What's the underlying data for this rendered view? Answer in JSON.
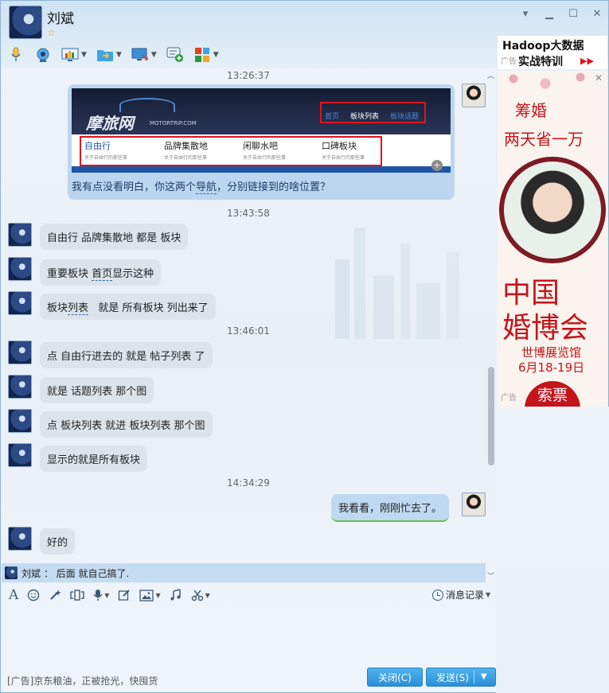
{
  "contact": {
    "name": "刘斌",
    "star": "☆"
  },
  "window": {
    "minimize_label": "▾",
    "min_label": "▁",
    "max_label": "☐",
    "close_label": "✕"
  },
  "chat": {
    "times": [
      "13:26:37",
      "13:43:58",
      "13:46:01",
      "14:34:29"
    ],
    "image_message": {
      "site_logo": "摩旅网",
      "site_logo_sub": "MOTORTRIP.COM",
      "site_nav": [
        "首页",
        "板块列表",
        "板块话题"
      ],
      "site_menu": [
        {
          "title": "自由行",
          "sub": "关于自由行的那些事"
        },
        {
          "title": "品牌集散地",
          "sub": "关于自由行的那些事"
        },
        {
          "title": "闲聊水吧",
          "sub": "关于自由行的那些事"
        },
        {
          "title": "口碑板块",
          "sub": "关于自由行的那些事"
        }
      ],
      "caption_a": "我有点没看明白，你这两个",
      "caption_link": "导航",
      "caption_b": "，分别链接到的啥位置？"
    },
    "messages": [
      {
        "text": "自由行 品牌集散地 都是 板块"
      },
      {
        "text_a": "重要板块 ",
        "link": "首页",
        "text_b": "显示这种"
      },
      {
        "text_a": "板块",
        "link": "列表",
        "text_b": "   就是 所有板块 列出来了"
      },
      {
        "text": "点 自由行进去的 就是 帖子列表 了"
      },
      {
        "text": "就是 话题列表 那个图"
      },
      {
        "text": "点 板块列表 就进 板块列表 那个图"
      },
      {
        "text": "显示的就是所有板块"
      },
      {
        "text": "我看看，刚刚忙去了。"
      },
      {
        "text": "好的"
      }
    ]
  },
  "status_line": "刘斌 ： 后面 就自己搞了.",
  "input_toolbar": {
    "history_label": "消息记录"
  },
  "footer": {
    "ad_text": "[广告]京东粮油，正被抢光，快囤货",
    "close_button": "关闭(C)",
    "send_button": "发送(S)"
  },
  "ads": {
    "ad1_line1": "Hadoop大数据",
    "ad1_line2": "实战特训",
    "ad1_tag": "广告",
    "ad2_h1": "筹婚",
    "ad2_h2": "两天省一万",
    "ad2_big1": "中国",
    "ad2_big2": "婚博会",
    "ad2_venue": "世博展览馆",
    "ad2_date": "6月18-19日",
    "ad2_button": "索票",
    "ad2_tag": "广告"
  },
  "colors": {
    "accent": "#2a8fd8",
    "ad_red": "#c4151c",
    "nav_box": "#e0141c"
  }
}
